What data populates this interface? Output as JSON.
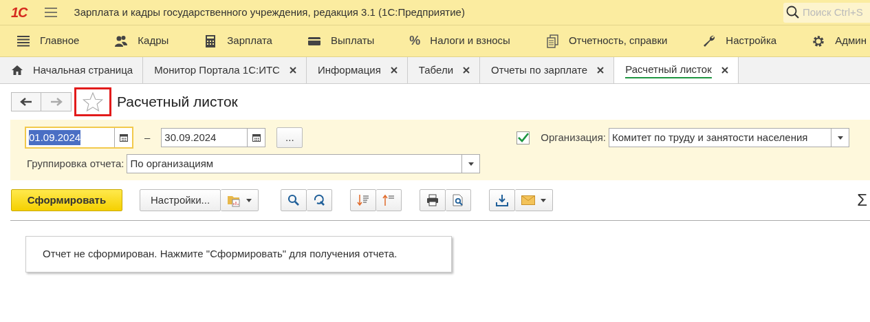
{
  "window": {
    "logo": "1С",
    "title": "Зарплата и кадры государственного учреждения, редакция 3.1  (1С:Предприятие)",
    "search": {
      "placeholder": "Поиск Ctrl+S"
    }
  },
  "sections": [
    {
      "label": "Главное"
    },
    {
      "label": "Кадры"
    },
    {
      "label": "Зарплата"
    },
    {
      "label": "Выплаты"
    },
    {
      "label": "Налоги и взносы",
      "icon_text": "%"
    },
    {
      "label": "Отчетность, справки"
    },
    {
      "label": "Настройка"
    },
    {
      "label": "Админ"
    }
  ],
  "tabs": [
    {
      "kind": "home",
      "label": "Начальная страница",
      "selected": false
    },
    {
      "kind": "doc",
      "label": "Монитор Портала 1С:ИТС",
      "selected": false
    },
    {
      "kind": "doc",
      "label": "Информация",
      "selected": false
    },
    {
      "kind": "doc",
      "label": "Табели",
      "selected": false
    },
    {
      "kind": "doc",
      "label": "Отчеты по зарплате",
      "selected": false
    },
    {
      "kind": "doc",
      "label": "Расчетный листок",
      "selected": true
    }
  ],
  "form": {
    "title": "Расчетный листок",
    "favorite": false,
    "period": {
      "from": "01.09.2024",
      "dash": "–",
      "to": "30.09.2024",
      "more": "..."
    },
    "organization": {
      "checked": true,
      "label": "Организация:",
      "value": "Комитет по труду и занятости населения"
    },
    "grouping": {
      "label": "Группировка отчета:",
      "value": "По организациям"
    },
    "toolbar": {
      "generate": "Сформировать",
      "settings": "Настройки...",
      "sum": "Σ"
    },
    "message": "Отчет не сформирован. Нажмите \"Сформировать\" для получения отчета."
  }
}
